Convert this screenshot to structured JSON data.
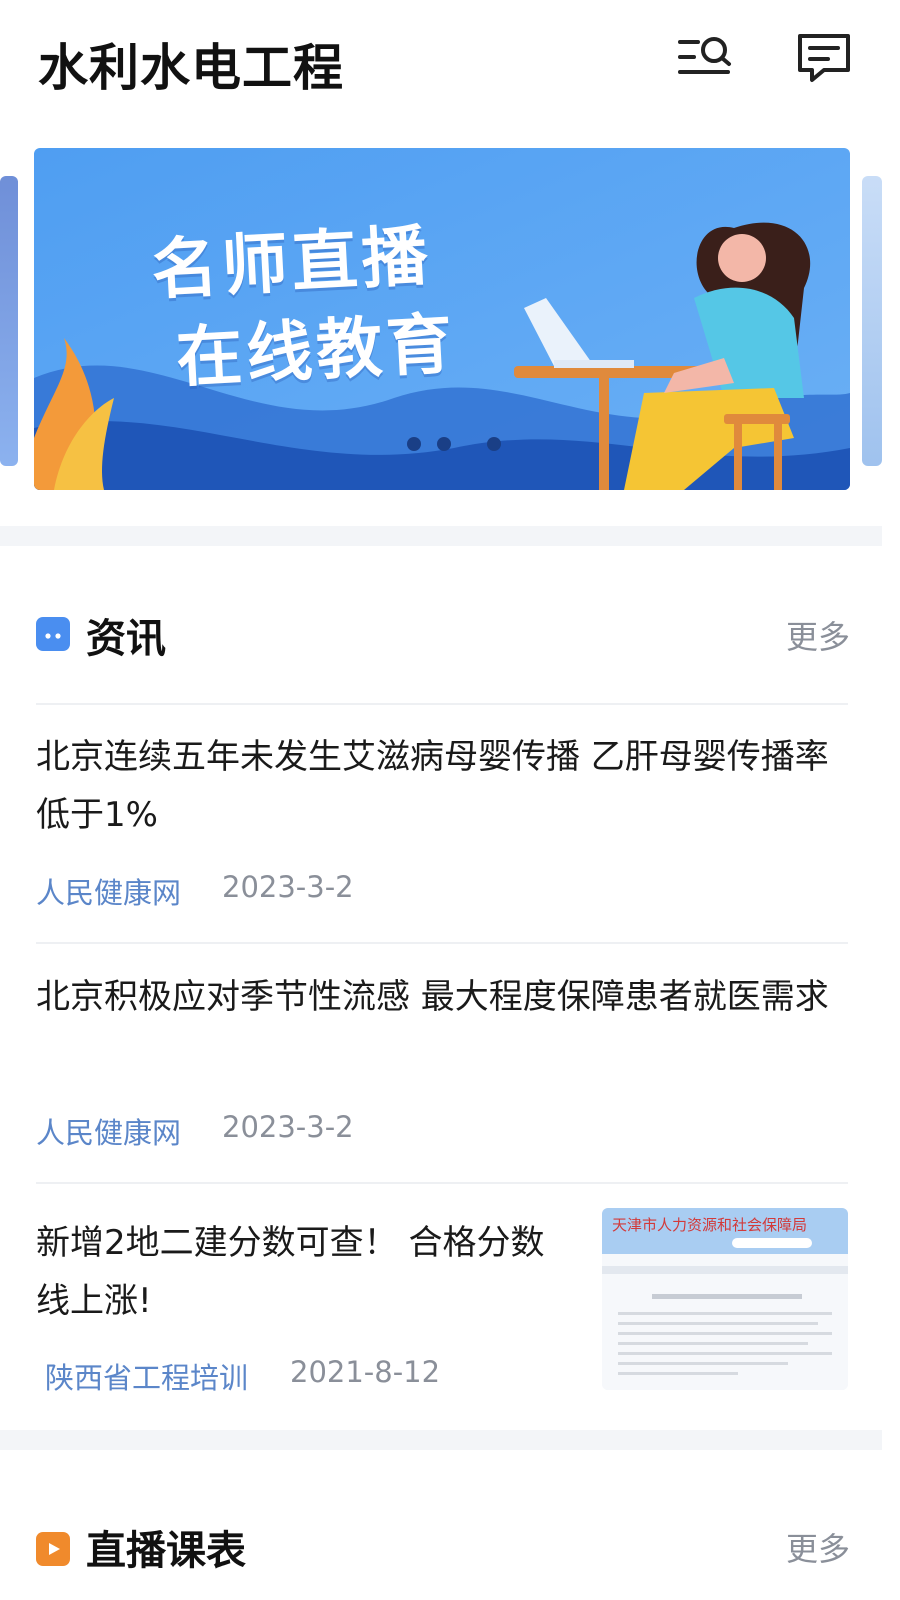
{
  "header": {
    "title": "水利水电工程"
  },
  "banner": {
    "line1": "名师直播",
    "line2": "在线教育"
  },
  "news_section": {
    "title": "资讯",
    "more_label": "更多",
    "icon_color": "#4a8ef0",
    "items": [
      {
        "title": "北京连续五年未发生艾滋病母婴传播 乙肝母婴传播率低于1%",
        "source": "人民健康网",
        "date": "2023-3-2"
      },
      {
        "title": "北京积极应对季节性流感 最大程度保障患者就医需求",
        "source": "人民健康网",
        "date": "2023-3-2"
      },
      {
        "title": "新增2地二建分数可查！ 合格分数线上涨!",
        "source": "陕西省工程培训",
        "date": "2021-8-12",
        "thumbnail_caption": "天津市人力资源和社会保障局"
      }
    ]
  },
  "live_section": {
    "title": "直播课表",
    "more_label": "更多",
    "icon_color": "#f08a2c"
  },
  "colors": {
    "source_link": "#5b86c9",
    "muted": "#8a8f99",
    "section_gap": "#f3f5f8"
  }
}
